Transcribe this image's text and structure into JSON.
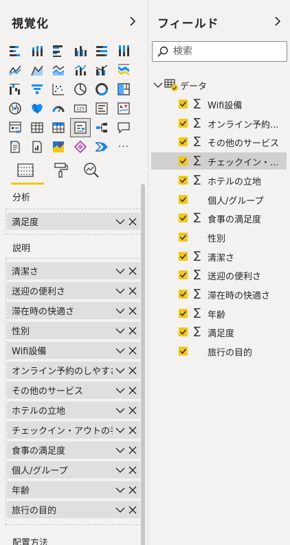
{
  "visualizations": {
    "title": "視覚化",
    "tab_build_icon": "fields-well-icon",
    "tab_format_icon": "paint-roller-icon",
    "tab_analytics_icon": "magnifier-chart-icon",
    "analysis_label": "分析",
    "analysis_field": "満足度",
    "explain_label": "説明",
    "explain_fields": [
      "清潔さ",
      "送迎の便利さ",
      "滞在時の快適さ",
      "性別",
      "Wifi設備",
      "オンライン予約のしやすさ",
      "その他のサービス",
      "ホテルの立地",
      "チェックイン・アウトの手続き",
      "食事の満足度",
      "個人/グループ",
      "年齢",
      "旅行の目的"
    ],
    "layout_label": "配置方法",
    "more_label": "···"
  },
  "fields": {
    "title": "フィールド",
    "search_placeholder": "検索",
    "table_name": "データ",
    "items": [
      {
        "label": "Wifi設備",
        "sigma": true
      },
      {
        "label": "オンライン予約...",
        "sigma": true
      },
      {
        "label": "その他のサービス",
        "sigma": true
      },
      {
        "label": "チェックイン・...",
        "sigma": true,
        "hover": true
      },
      {
        "label": "ホテルの立地",
        "sigma": true
      },
      {
        "label": "個人/グループ",
        "sigma": false
      },
      {
        "label": "食事の満足度",
        "sigma": true
      },
      {
        "label": "性別",
        "sigma": false
      },
      {
        "label": "清潔さ",
        "sigma": true
      },
      {
        "label": "送迎の便利さ",
        "sigma": true
      },
      {
        "label": "滞在時の快適さ",
        "sigma": true
      },
      {
        "label": "年齢",
        "sigma": true
      },
      {
        "label": "満足度",
        "sigma": true
      },
      {
        "label": "旅行の目的",
        "sigma": false
      }
    ]
  },
  "colors": {
    "accent": "#f2c811",
    "pane_bg": "#f3f2f1",
    "well_bg": "#e1dfdd",
    "icon_dark": "#3b3a39",
    "icon_blue": "#118dff"
  },
  "sigma_symbol": "∑"
}
